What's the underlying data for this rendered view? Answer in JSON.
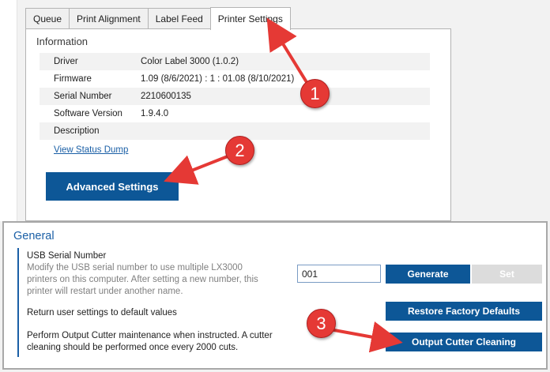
{
  "tabs": [
    {
      "label": "Queue"
    },
    {
      "label": "Print Alignment"
    },
    {
      "label": "Label Feed"
    },
    {
      "label": "Printer Settings"
    }
  ],
  "information": {
    "title": "Information",
    "rows": [
      {
        "label": "Driver",
        "value": "Color Label 3000 (1.0.2)"
      },
      {
        "label": "Firmware",
        "value": "1.09 (8/6/2021) : 1 : 01.08 (8/10/2021)"
      },
      {
        "label": "Serial Number",
        "value": "2210600135"
      },
      {
        "label": "Software Version",
        "value": "1.9.4.0"
      },
      {
        "label": "Description",
        "value": ""
      }
    ],
    "status_link": "View Status Dump",
    "advanced_button": "Advanced Settings"
  },
  "general": {
    "title": "General",
    "usb_title": "USB Serial Number",
    "usb_desc_1": "Modify the USB serial number to use multiple LX3000",
    "usb_desc_2": "printers on this computer. After setting a new number, this",
    "usb_desc_3": "printer will restart under another name.",
    "serial_value": "001",
    "generate_button": "Generate",
    "set_button": "Set",
    "restore_text": "Return user settings to default values",
    "restore_button": "Restore Factory Defaults",
    "cutter_text_1": "Perform Output Cutter maintenance when instructed. A cutter",
    "cutter_text_2": "cleaning should be performed once every 2000 cuts.",
    "cutter_button": "Output Cutter Cleaning"
  },
  "callouts": [
    "1",
    "2",
    "3"
  ],
  "colors": {
    "accent": "#0d5797",
    "callout": "#e53935",
    "link": "#1a5fa6"
  }
}
